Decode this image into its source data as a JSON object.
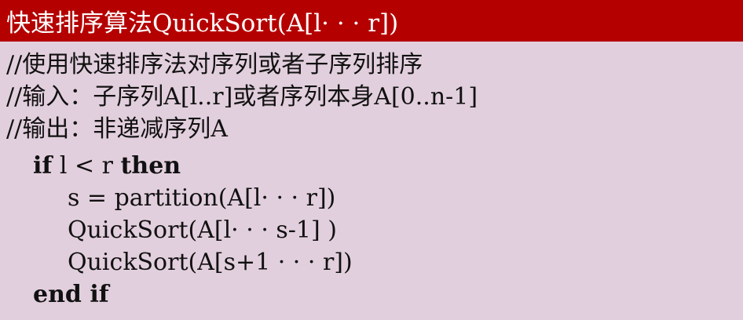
{
  "title": "快速排序算法QuickSort(A[l· · · r])",
  "comments": [
    "//使用快速排序法对序列或者子序列排序",
    "//输入：子序列A[l..r]或者序列本身A[0..n-1]",
    "//输出：非递减序列A"
  ],
  "code": {
    "if_keyword": "if",
    "condition": " l < r ",
    "then_keyword": "then",
    "body": [
      "s = partition(A[l· · · r])",
      "QuickSort(A[l· · · s-1] )",
      "QuickSort(A[s+1 · · · r])"
    ],
    "end_keyword": "end if"
  },
  "colors": {
    "title_background": "#b50000",
    "title_text": "#ffffff",
    "panel_background": "#e2cfdd",
    "text": "#111111"
  }
}
